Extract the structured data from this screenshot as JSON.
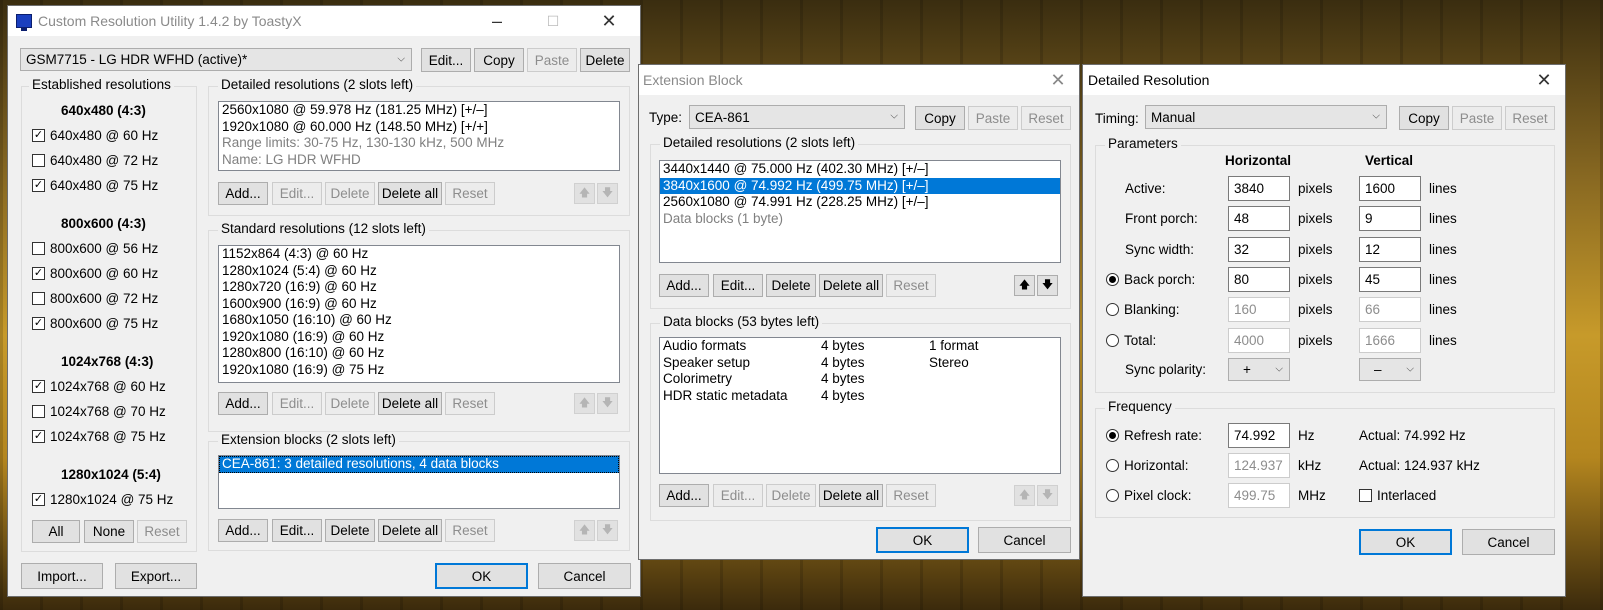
{
  "main": {
    "title": "Custom Resolution Utility 1.4.2 by ToastyX",
    "monitor_select": "GSM7715 - LG HDR WFHD (active)*",
    "buttons": {
      "edit": "Edit...",
      "copy": "Copy",
      "paste": "Paste",
      "delete": "Delete"
    },
    "established": {
      "label": "Established resolutions",
      "groups": [
        {
          "header": "640x480 (4:3)",
          "items": [
            {
              "label": "640x480 @ 60 Hz",
              "checked": true
            },
            {
              "label": "640x480 @ 72 Hz",
              "checked": false
            },
            {
              "label": "640x480 @ 75 Hz",
              "checked": true
            }
          ]
        },
        {
          "header": "800x600 (4:3)",
          "items": [
            {
              "label": "800x600 @ 56 Hz",
              "checked": false
            },
            {
              "label": "800x600 @ 60 Hz",
              "checked": true
            },
            {
              "label": "800x600 @ 72 Hz",
              "checked": false
            },
            {
              "label": "800x600 @ 75 Hz",
              "checked": true
            }
          ]
        },
        {
          "header": "1024x768 (4:3)",
          "items": [
            {
              "label": "1024x768 @ 60 Hz",
              "checked": true
            },
            {
              "label": "1024x768 @ 70 Hz",
              "checked": false
            },
            {
              "label": "1024x768 @ 75 Hz",
              "checked": true
            }
          ]
        },
        {
          "header": "1280x1024 (5:4)",
          "items": [
            {
              "label": "1280x1024 @ 75 Hz",
              "checked": true
            }
          ]
        }
      ],
      "all": "All",
      "none": "None",
      "reset": "Reset"
    },
    "detailed": {
      "label": "Detailed resolutions (2 slots left)",
      "items": [
        {
          "text": "2560x1080 @ 59.978 Hz (181.25 MHz) [+/–]",
          "gray": false
        },
        {
          "text": "1920x1080 @ 60.000 Hz (148.50 MHz) [+/+]",
          "gray": false
        },
        {
          "text": "Range limits: 30-75 Hz, 130-130 kHz, 500 MHz",
          "gray": true
        },
        {
          "text": "Name: LG HDR WFHD",
          "gray": true
        }
      ],
      "add": "Add...",
      "edit": "Edit...",
      "delete": "Delete",
      "delete_all": "Delete all",
      "reset": "Reset"
    },
    "standard": {
      "label": "Standard resolutions (12 slots left)",
      "items": [
        "1152x864 (4:3) @ 60 Hz",
        "1280x1024 (5:4) @ 60 Hz",
        "1280x720 (16:9) @ 60 Hz",
        "1600x900 (16:9) @ 60 Hz",
        "1680x1050 (16:10) @ 60 Hz",
        "1920x1080 (16:9) @ 60 Hz",
        "1280x800 (16:10) @ 60 Hz",
        "1920x1080 (16:9) @ 75 Hz"
      ],
      "add": "Add...",
      "edit": "Edit...",
      "delete": "Delete",
      "delete_all": "Delete all",
      "reset": "Reset"
    },
    "extension": {
      "label": "Extension blocks (2 slots left)",
      "items": [
        "CEA-861: 3 detailed resolutions, 4 data blocks"
      ],
      "add": "Add...",
      "edit": "Edit...",
      "delete": "Delete",
      "delete_all": "Delete all",
      "reset": "Reset"
    },
    "import": "Import...",
    "export": "Export...",
    "ok": "OK",
    "cancel": "Cancel"
  },
  "ext": {
    "title": "Extension Block",
    "type_label": "Type:",
    "type_value": "CEA-861",
    "copy": "Copy",
    "paste": "Paste",
    "reset": "Reset",
    "detailed_label": "Detailed resolutions (2 slots left)",
    "detailed_items": [
      {
        "text": "3440x1440 @ 75.000 Hz (402.30 MHz) [+/–]",
        "state": "normal"
      },
      {
        "text": "3840x1600 @ 74.992 Hz (499.75 MHz) [+/–]",
        "state": "selected"
      },
      {
        "text": "2560x1080 @ 74.991 Hz (228.25 MHz) [+/–]",
        "state": "normal"
      },
      {
        "text": "Data blocks (1 byte)",
        "state": "gray"
      }
    ],
    "add": "Add...",
    "edit": "Edit...",
    "delete": "Delete",
    "delete_all": "Delete all",
    "reset2": "Reset",
    "data_label": "Data blocks (53 bytes left)",
    "data_rows": [
      [
        "Audio formats",
        "4 bytes",
        "1 format"
      ],
      [
        "Speaker setup",
        "4 bytes",
        "Stereo"
      ],
      [
        "Colorimetry",
        "4 bytes",
        ""
      ],
      [
        "HDR static metadata",
        "4 bytes",
        ""
      ]
    ],
    "ok": "OK",
    "cancel": "Cancel"
  },
  "detail": {
    "title": "Detailed Resolution",
    "timing_label": "Timing:",
    "timing_value": "Manual",
    "copy": "Copy",
    "paste": "Paste",
    "reset": "Reset",
    "params_label": "Parameters",
    "col_h": "Horizontal",
    "col_v": "Vertical",
    "rows": [
      {
        "label": "Active:",
        "h": "3840",
        "v": "1600",
        "radio": false,
        "enabled": true
      },
      {
        "label": "Front porch:",
        "h": "48",
        "v": "9",
        "radio": false,
        "enabled": true
      },
      {
        "label": "Sync width:",
        "h": "32",
        "v": "12",
        "radio": false,
        "enabled": true
      },
      {
        "label": "Back porch:",
        "h": "80",
        "v": "45",
        "radio": true,
        "selected": true,
        "enabled": true
      },
      {
        "label": "Blanking:",
        "h": "160",
        "v": "66",
        "radio": true,
        "selected": false,
        "enabled": false
      },
      {
        "label": "Total:",
        "h": "4000",
        "v": "1666",
        "radio": true,
        "selected": false,
        "enabled": false
      }
    ],
    "unit_h": "pixels",
    "unit_v": "lines",
    "sync_label": "Sync polarity:",
    "sync_h": "+",
    "sync_v": "–",
    "freq_label": "Frequency",
    "refresh_label": "Refresh rate:",
    "refresh_value": "74.992",
    "refresh_unit": "Hz",
    "refresh_actual": "Actual: 74.992 Hz",
    "horiz_label": "Horizontal:",
    "horiz_value": "124.937",
    "horiz_unit": "kHz",
    "horiz_actual": "Actual: 124.937 kHz",
    "pclk_label": "Pixel clock:",
    "pclk_value": "499.75",
    "pclk_unit": "MHz",
    "interlaced": "Interlaced",
    "ok": "OK",
    "cancel": "Cancel"
  }
}
